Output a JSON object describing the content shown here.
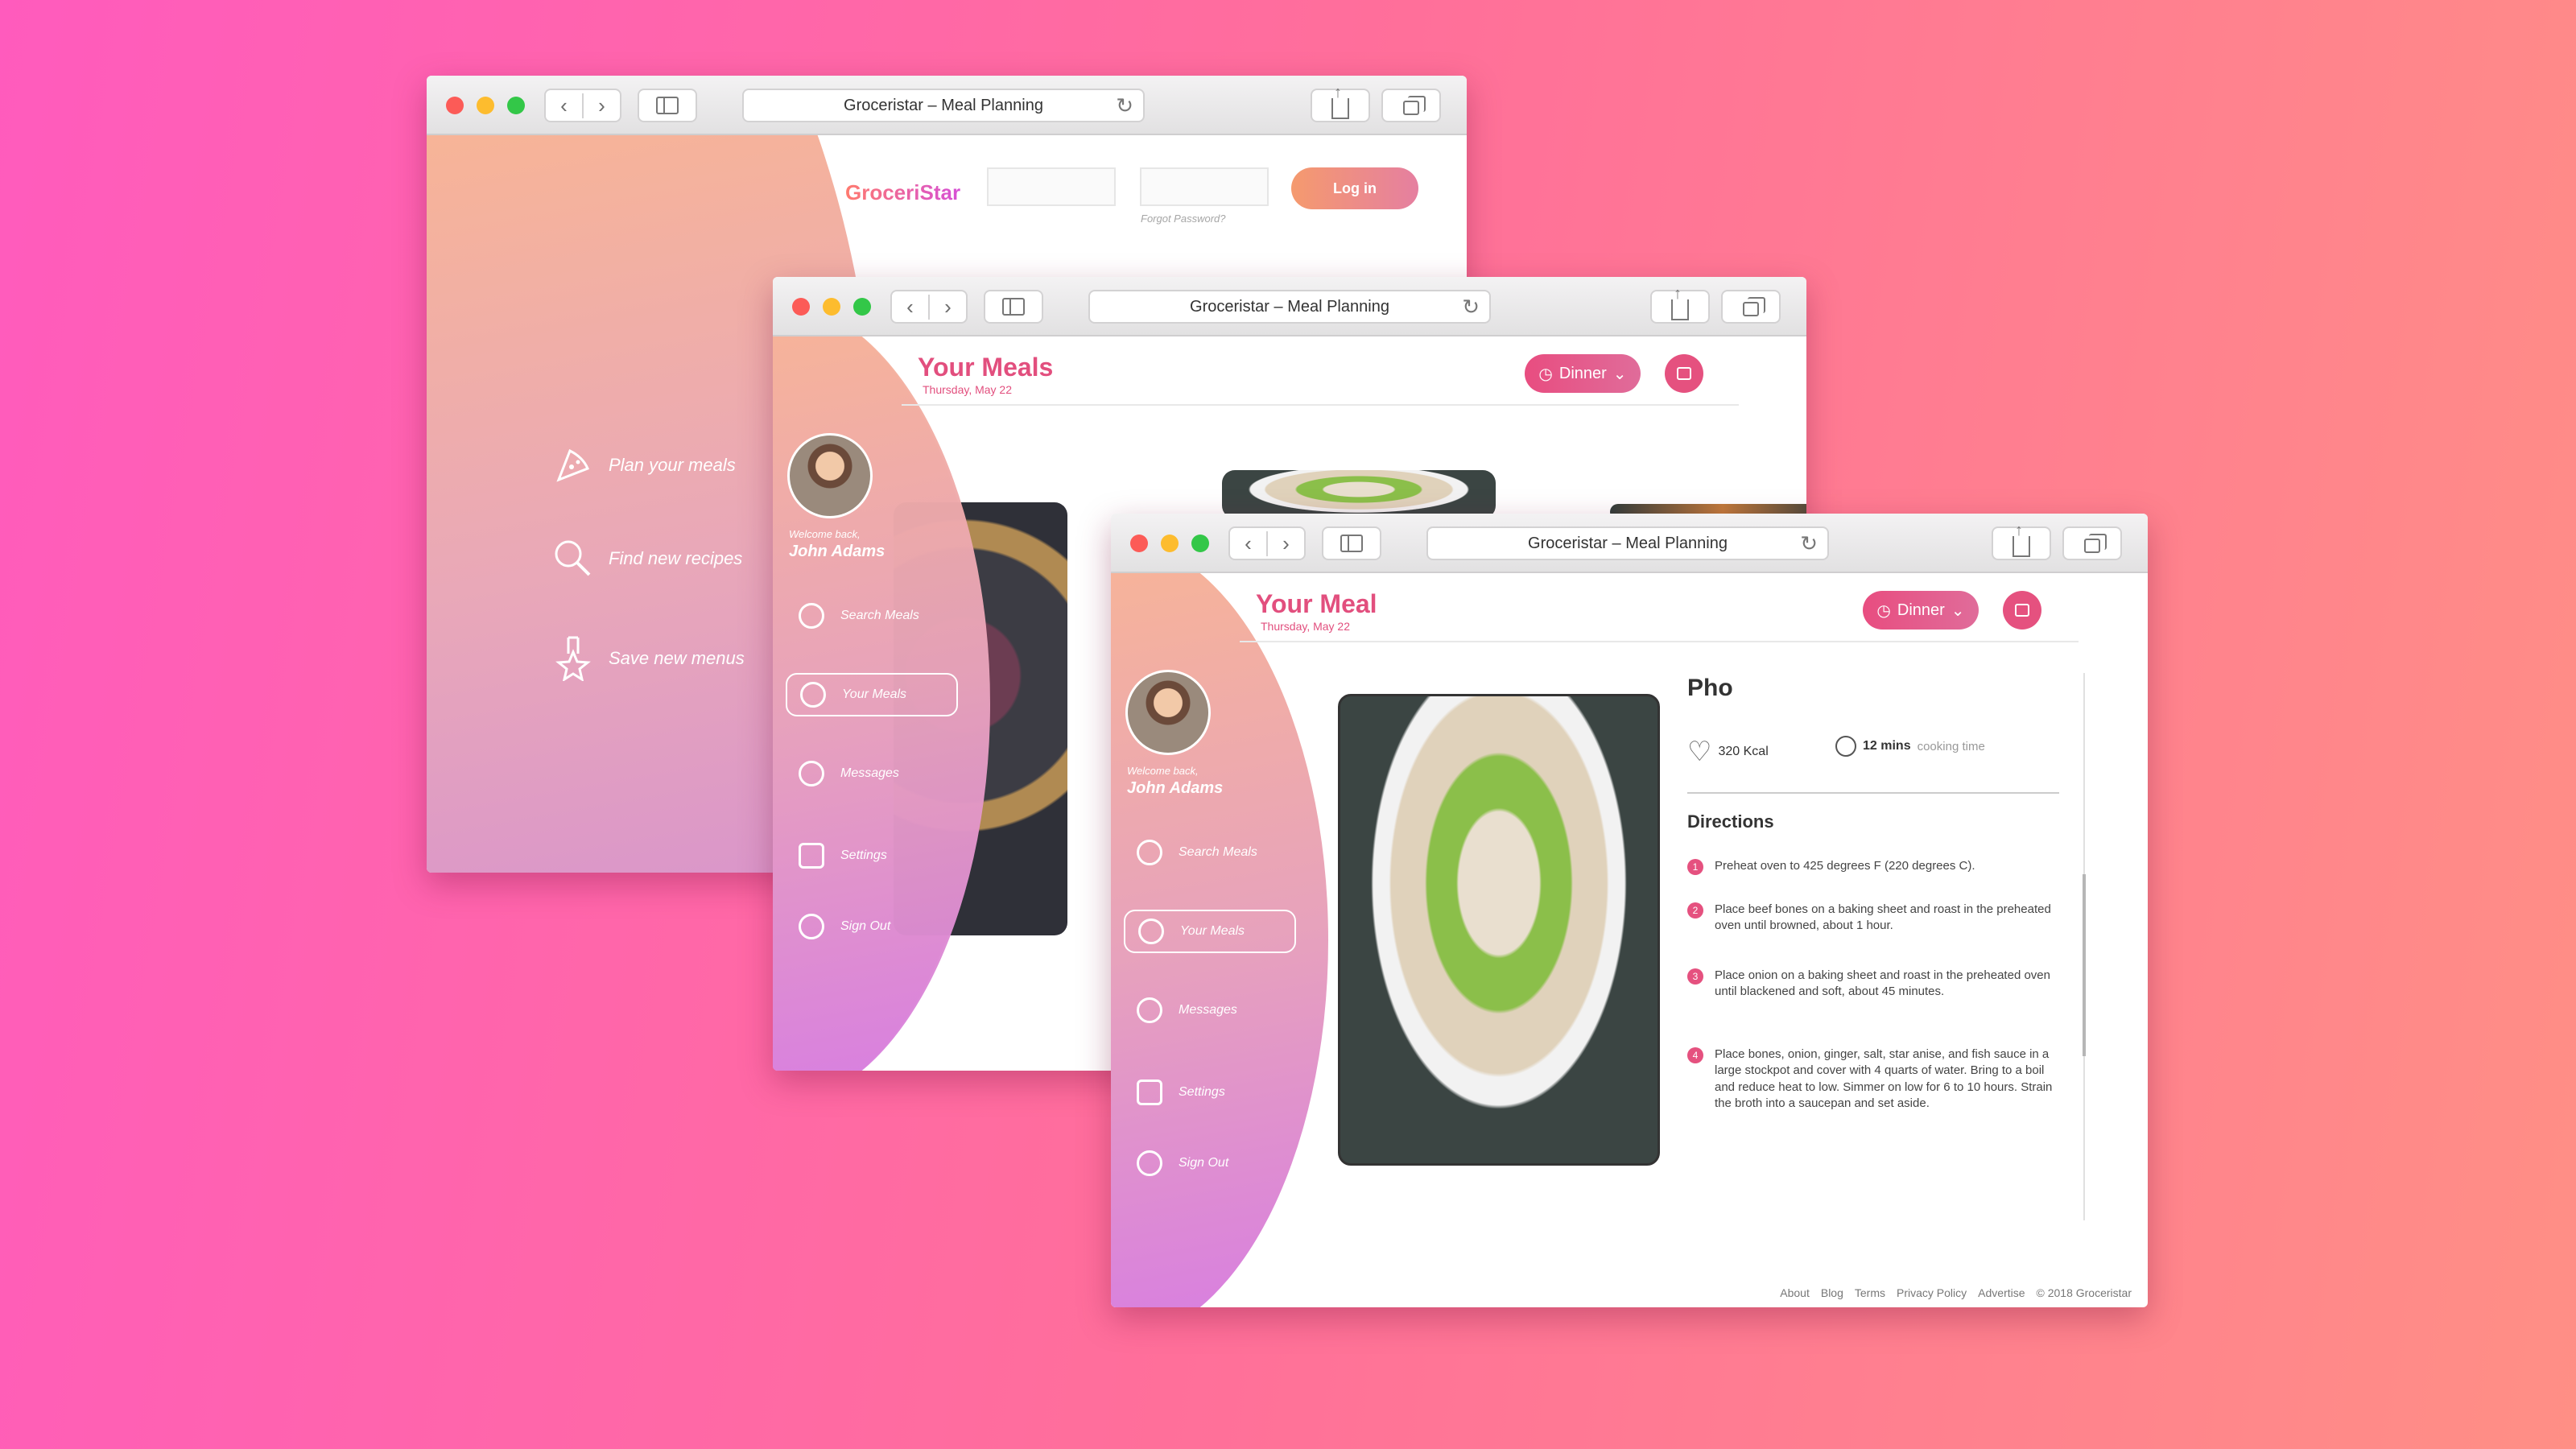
{
  "browser": {
    "address_title": "Groceristar – Meal Planning"
  },
  "login_window": {
    "brand": "GroceriStar",
    "forgot_password": "Forgot Password?",
    "login_button": "Log in",
    "features": [
      {
        "icon": "pizza-icon",
        "label": "Plan your meals"
      },
      {
        "icon": "search-icon",
        "label": "Find new recipes"
      },
      {
        "icon": "star-ribbon-icon",
        "label": "Save new menus"
      }
    ]
  },
  "app": {
    "user": {
      "welcome": "Welcome back,",
      "name": "John Adams"
    },
    "nav": [
      {
        "icon": "search-icon",
        "label": "Search Meals"
      },
      {
        "icon": "cupcake-icon",
        "label": "Your Meals"
      },
      {
        "icon": "chat-bubble-icon",
        "label": "Messages"
      },
      {
        "icon": "sliders-icon",
        "label": "Settings"
      },
      {
        "icon": "power-icon",
        "label": "Sign Out"
      }
    ],
    "date": "Thursday, May 22",
    "meal_selector": "Dinner"
  },
  "meals_window": {
    "title": "Your Meals"
  },
  "meal_window": {
    "title": "Your Meal",
    "dish": {
      "name": "Pho",
      "calories": "320 Kcal",
      "cook_time": "12 mins",
      "cook_time_label": "cooking time",
      "directions_heading": "Directions",
      "steps": [
        {
          "num": "1",
          "text": "Preheat oven to 425 degrees F (220 degrees C)."
        },
        {
          "num": "2",
          "text": "Place beef bones on a baking sheet and roast in the preheated oven until browned, about 1 hour."
        },
        {
          "num": "3",
          "text": "Place onion on a baking sheet and roast in the preheated oven until blackened and soft, about 45 minutes."
        },
        {
          "num": "4",
          "text": "Place bones, onion, ginger, salt, star anise, and fish sauce in a large stockpot and cover with 4 quarts of water. Bring to a boil and reduce heat to low. Simmer on low for 6 to 10 hours. Strain the broth into a saucepan and set aside."
        }
      ]
    },
    "footer": [
      "About",
      "Blog",
      "Terms",
      "Privacy Policy",
      "Advertise",
      "© 2018 Groceristar"
    ]
  },
  "colors": {
    "accent": "#e5517f",
    "background_start": "#ff5bbd",
    "background_end": "#ff8f85"
  }
}
